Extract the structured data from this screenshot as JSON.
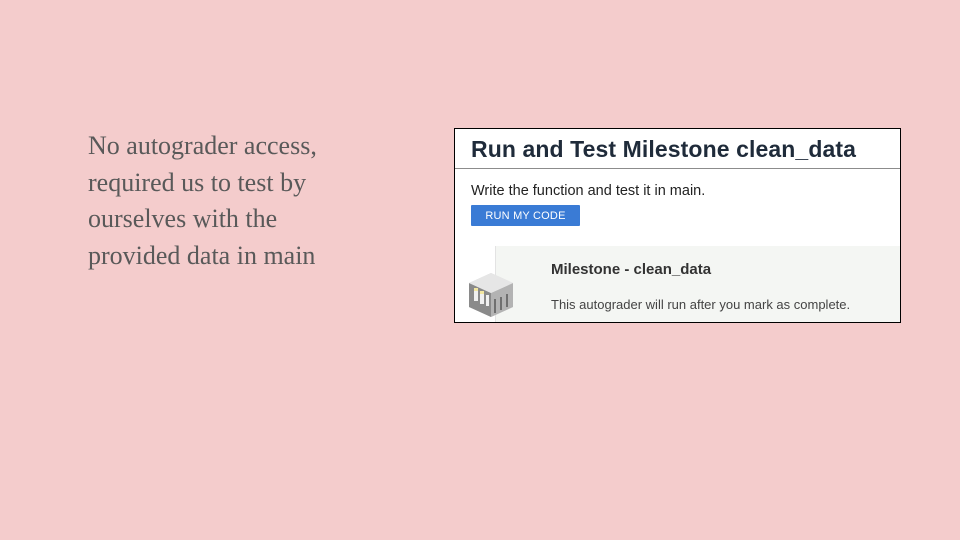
{
  "slide": {
    "text_lines": [
      "No autograder access,",
      "required us to test by",
      "ourselves with the",
      "provided data in main"
    ]
  },
  "screenshot": {
    "title": "Run and Test Milestone clean_data",
    "description": "Write the function and test it in main.",
    "run_button_label": "RUN MY CODE",
    "milestone": {
      "icon": "autograder-machine-icon",
      "title": "Milestone - clean_data",
      "description": "This autograder will run after you mark as complete."
    }
  },
  "colors": {
    "background": "#f4cccc",
    "button": "#3a7bd5",
    "card": "#f4f6f3"
  }
}
